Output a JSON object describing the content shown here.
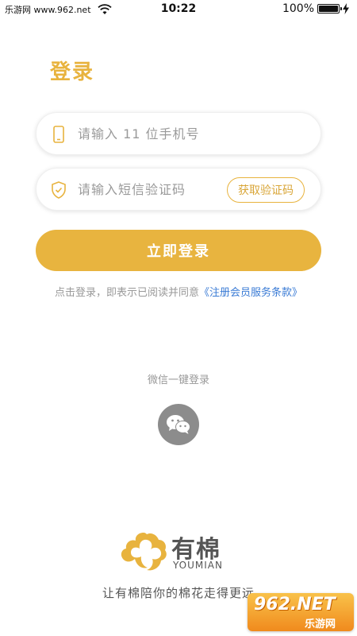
{
  "status_bar": {
    "carrier": "乐游网 www.962.net",
    "signal": "●●●",
    "time": "10:22",
    "battery": "100%"
  },
  "login": {
    "title": "登录",
    "phone_placeholder": "请输入 11 位手机号",
    "code_placeholder": "请输入短信验证码",
    "get_code_label": "获取验证码",
    "submit_label": "立即登录",
    "agreement_prefix": "点击登录，即表示已阅读并同意",
    "agreement_link": "《注册会员服务条款》"
  },
  "wechat": {
    "label": "微信一键登录",
    "icon": "wechat-icon"
  },
  "brand": {
    "name": "有棉",
    "latin": "YOUMIAN",
    "slogan": "让有棉陪你的棉花走得更远"
  },
  "watermark": {
    "main": "962.NET",
    "sub": "乐游网"
  },
  "colors": {
    "accent": "#E8B33E",
    "link": "#3a7bd5",
    "muted": "#999999"
  }
}
